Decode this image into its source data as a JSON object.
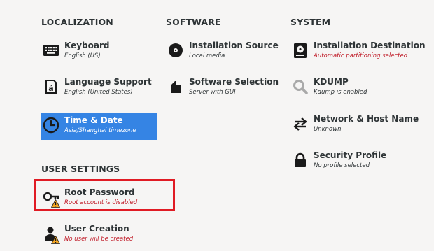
{
  "sections": {
    "localization": "LOCALIZATION",
    "software": "SOFTWARE",
    "system": "SYSTEM",
    "user_settings": "USER SETTINGS"
  },
  "spokes": {
    "keyboard": {
      "title": "Keyboard",
      "status": "English (US)",
      "icon": "keyboard-icon"
    },
    "language": {
      "title": "Language Support",
      "status": "English (United States)",
      "icon": "language-icon"
    },
    "time": {
      "title": "Time & Date",
      "status": "Asia/Shanghai timezone",
      "icon": "clock-icon",
      "selected": true
    },
    "source": {
      "title": "Installation Source",
      "status": "Local media",
      "icon": "disc-icon"
    },
    "software_selection": {
      "title": "Software Selection",
      "status": "Server with GUI",
      "icon": "package-icon"
    },
    "destination": {
      "title": "Installation Destination",
      "status": "Automatic partitioning selected",
      "icon": "hard-disk-icon",
      "status_type": "error"
    },
    "kdump": {
      "title": "KDUMP",
      "status": "Kdump is enabled",
      "icon": "magnifier-icon"
    },
    "network": {
      "title": "Network & Host Name",
      "status": "Unknown",
      "icon": "network-arrows-icon"
    },
    "security": {
      "title": "Security Profile",
      "status": "No profile selected",
      "icon": "lock-icon"
    },
    "root": {
      "title": "Root Password",
      "status": "Root account is disabled",
      "icon": "key-icon",
      "status_type": "error",
      "warning": true
    },
    "user": {
      "title": "User Creation",
      "status": "No user will be created",
      "icon": "user-icon",
      "status_type": "error",
      "warning": true
    }
  },
  "colors": {
    "background": "#f6f5f4",
    "selected": "#3584e4",
    "error": "#c01c28",
    "highlight": "#e01b24",
    "warning": "#f5a623"
  }
}
